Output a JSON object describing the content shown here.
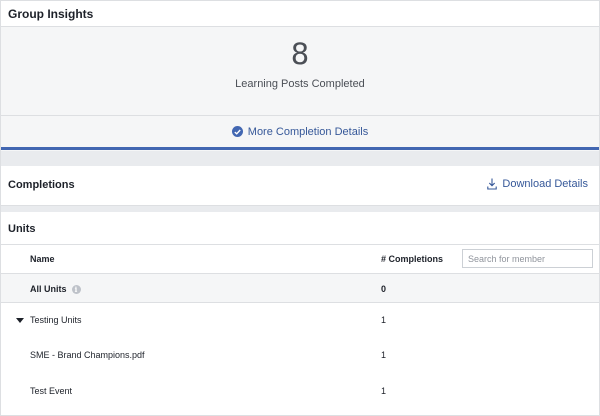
{
  "group_insights": {
    "title": "Group Insights",
    "stat_value": "8",
    "stat_label": "Learning Posts Completed",
    "details_link": "More Completion Details"
  },
  "completions": {
    "title": "Completions",
    "download_label": "Download Details"
  },
  "units": {
    "title": "Units",
    "columns": {
      "name": "Name",
      "completions": "# Completions"
    },
    "search_placeholder": "Search for member",
    "all_units": {
      "name": "All Units",
      "count": "0"
    },
    "rows": [
      {
        "name": "Testing Units",
        "count": "1"
      },
      {
        "name": "SME - Brand Champions.pdf",
        "count": "1"
      },
      {
        "name": "Test Event",
        "count": "1"
      }
    ]
  },
  "colors": {
    "accent": "#4267b2",
    "link": "#365899",
    "background": "#e9ebee"
  },
  "icons": [
    "check-circle-icon",
    "download-icon",
    "info-icon",
    "caret-down-icon"
  ]
}
